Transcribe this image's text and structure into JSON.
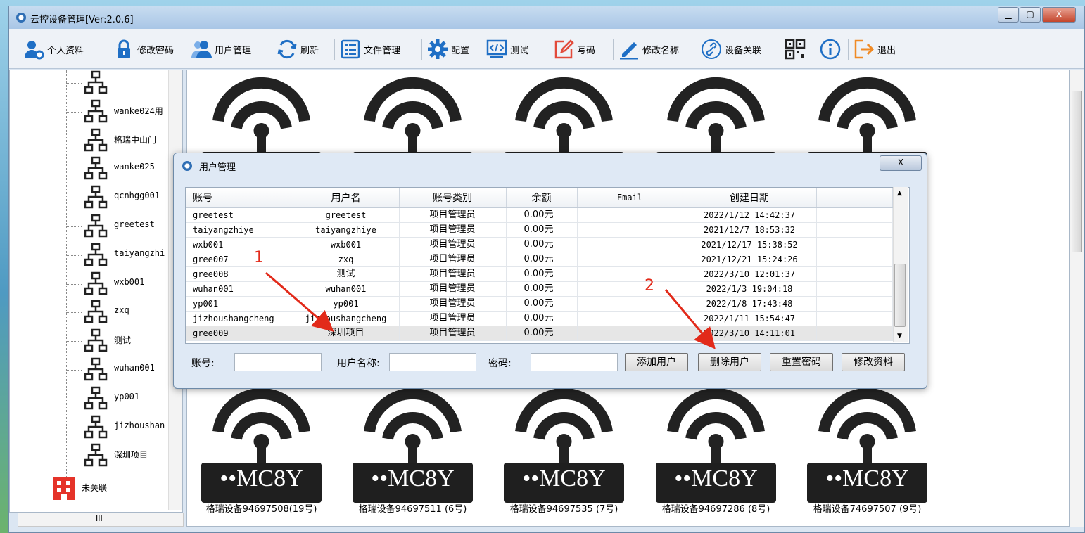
{
  "window": {
    "title": "云控设备管理[Ver:2.0.6]",
    "min": "▁",
    "max": "▢",
    "close": "X"
  },
  "toolbar": {
    "items": [
      {
        "label": "个人资料",
        "icon": "user-settings-icon"
      },
      {
        "label": "修改密码",
        "icon": "lock-icon"
      },
      {
        "label": "用户管理",
        "icon": "users-icon"
      },
      {
        "label": "刷新",
        "icon": "refresh-icon"
      },
      {
        "label": "文件管理",
        "icon": "file-list-icon"
      },
      {
        "label": "配置",
        "icon": "gear-icon"
      },
      {
        "label": "测试",
        "icon": "code-monitor-icon"
      },
      {
        "label": "写码",
        "icon": "edit-box-icon"
      },
      {
        "label": "修改名称",
        "icon": "pen-icon"
      },
      {
        "label": "设备关联",
        "icon": "link-icon"
      },
      {
        "label": "",
        "icon": "qr-code-icon"
      },
      {
        "label": "",
        "icon": "info-icon"
      },
      {
        "label": "退出",
        "icon": "exit-icon"
      }
    ]
  },
  "tree": {
    "items": [
      "",
      "wanke024用",
      "格瑞中山门",
      "wanke025",
      "qcnhgg001",
      "greetest",
      "taiyangzhi",
      "wxb001",
      "zxq",
      "测试",
      "wuhan001",
      "yp001",
      "jizhoushan",
      "深圳项目"
    ],
    "unlinked": "未关联",
    "hscroll_mark": "III"
  },
  "devices": {
    "brand": "••MC8Y",
    "bottom_labels": [
      "格瑞设备94697508(19号)",
      "格瑞设备94697511 (6号)",
      "格瑞设备94697535 (7号)",
      "格瑞设备94697286 (8号)",
      "格瑞设备74697507 (9号)"
    ]
  },
  "dialog": {
    "title": "用户管理",
    "close": "X",
    "columns": [
      "账号",
      "用户名",
      "账号类别",
      "余额",
      "Email",
      "创建日期"
    ],
    "rows": [
      {
        "account": "greetest",
        "username": "greetest",
        "type": "项目管理员",
        "balance": "0.00元",
        "email": "",
        "created": "2022/1/12 14:42:37"
      },
      {
        "account": "taiyangzhiye",
        "username": "taiyangzhiye",
        "type": "项目管理员",
        "balance": "0.00元",
        "email": "",
        "created": "2021/12/7 18:53:32"
      },
      {
        "account": "wxb001",
        "username": "wxb001",
        "type": "项目管理员",
        "balance": "0.00元",
        "email": "",
        "created": "2021/12/17 15:38:52"
      },
      {
        "account": "gree007",
        "username": "zxq",
        "type": "项目管理员",
        "balance": "0.00元",
        "email": "",
        "created": "2021/12/21 15:24:26"
      },
      {
        "account": "gree008",
        "username": "测试",
        "type": "项目管理员",
        "balance": "0.00元",
        "email": "",
        "created": "2022/3/10 12:01:37"
      },
      {
        "account": "wuhan001",
        "username": "wuhan001",
        "type": "项目管理员",
        "balance": "0.00元",
        "email": "",
        "created": "2022/1/3 19:04:18"
      },
      {
        "account": "yp001",
        "username": "yp001",
        "type": "项目管理员",
        "balance": "0.00元",
        "email": "",
        "created": "2022/1/8 17:43:48"
      },
      {
        "account": "jizhoushangcheng",
        "username": "jizhoushangcheng",
        "type": "项目管理员",
        "balance": "0.00元",
        "email": "",
        "created": "2022/1/11 15:54:47"
      },
      {
        "account": "gree009",
        "username": "深圳项目",
        "type": "项目管理员",
        "balance": "0.00元",
        "email": "",
        "created": "2022/3/10 14:11:01"
      }
    ],
    "form": {
      "account_label": "账号:",
      "username_label": "用户名称:",
      "password_label": "密码:",
      "account_value": "",
      "username_value": "",
      "password_value": ""
    },
    "buttons": {
      "add": "添加用户",
      "delete": "删除用户",
      "reset": "重置密码",
      "edit": "修改资料"
    }
  },
  "annotations": {
    "one": "1",
    "two": "2"
  },
  "colors": {
    "annotation": "#e22a1a",
    "accent": "#1f6fc5",
    "exit": "#f08a24"
  }
}
